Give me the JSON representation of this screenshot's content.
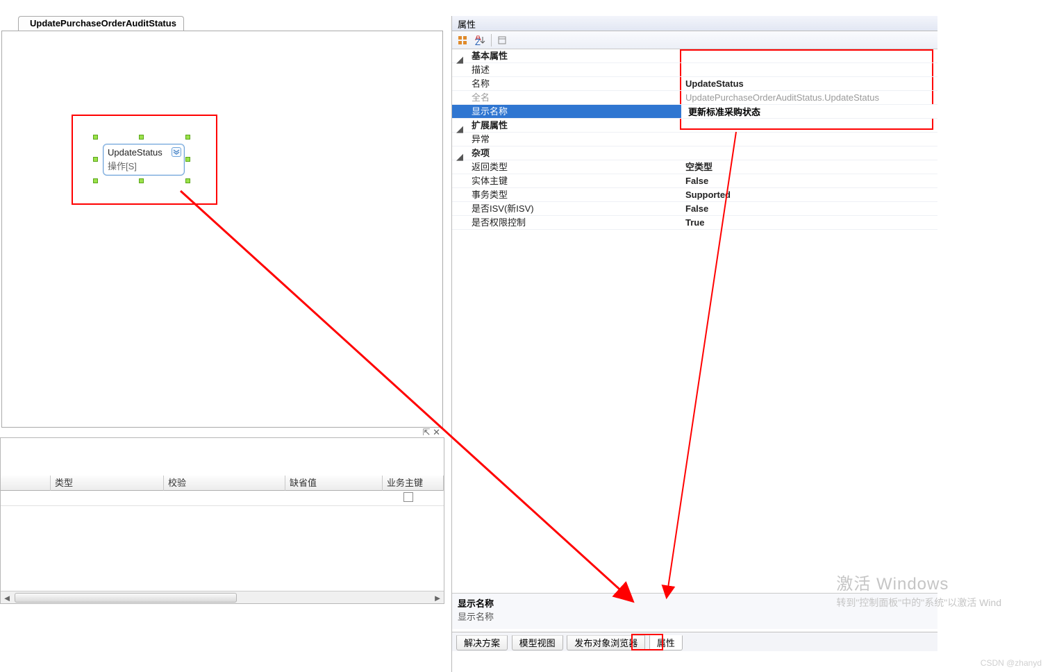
{
  "designer": {
    "tab_title": "UpdatePurchaseOrderAuditStatus",
    "tab_close_glyphs": "⌄ ✕",
    "node": {
      "title": "UpdateStatus",
      "sub": "操作[S]"
    }
  },
  "lower_panel": {
    "pin_glyphs": "⇱ ✕",
    "columns": {
      "type": "类型",
      "validate": "校验",
      "default": "缺省值",
      "biz_key": "业务主键"
    }
  },
  "properties": {
    "panel_title": "属性",
    "toolbar": {
      "cat_icon": "⊞",
      "az_icon": "A↓Z",
      "page_icon": "▭"
    },
    "categories": {
      "basic": "基本属性",
      "ext": "扩展属性",
      "misc": "杂项"
    },
    "rows": {
      "desc": {
        "label": "描述",
        "value": ""
      },
      "name": {
        "label": "名称",
        "value": "UpdateStatus"
      },
      "fullname": {
        "label": "全名",
        "value": "UpdatePurchaseOrderAuditStatus.UpdateStatus"
      },
      "display": {
        "label": "显示名称",
        "value": "更新标准采购状态"
      },
      "exception": {
        "label": "异常",
        "value": ""
      },
      "return_type": {
        "label": "返回类型",
        "value": "空类型"
      },
      "entity_pk": {
        "label": "实体主键",
        "value": "False"
      },
      "trans_type": {
        "label": "事务类型",
        "value": "Supported"
      },
      "is_isv": {
        "label": "是否ISV(新ISV)",
        "value": "False"
      },
      "is_perm": {
        "label": "是否权限控制",
        "value": "True"
      }
    },
    "desc_pane": {
      "title": "显示名称",
      "text": "显示名称"
    },
    "tabs": {
      "solution": "解决方案",
      "model_view": "模型视图",
      "publish_browser": "发布对象浏览器",
      "properties": "属性"
    }
  },
  "watermark": {
    "big": "激活 Windows",
    "small": "转到\"控制面板\"中的\"系统\"以激活 Wind"
  },
  "csdn": "CSDN @zhanyd"
}
